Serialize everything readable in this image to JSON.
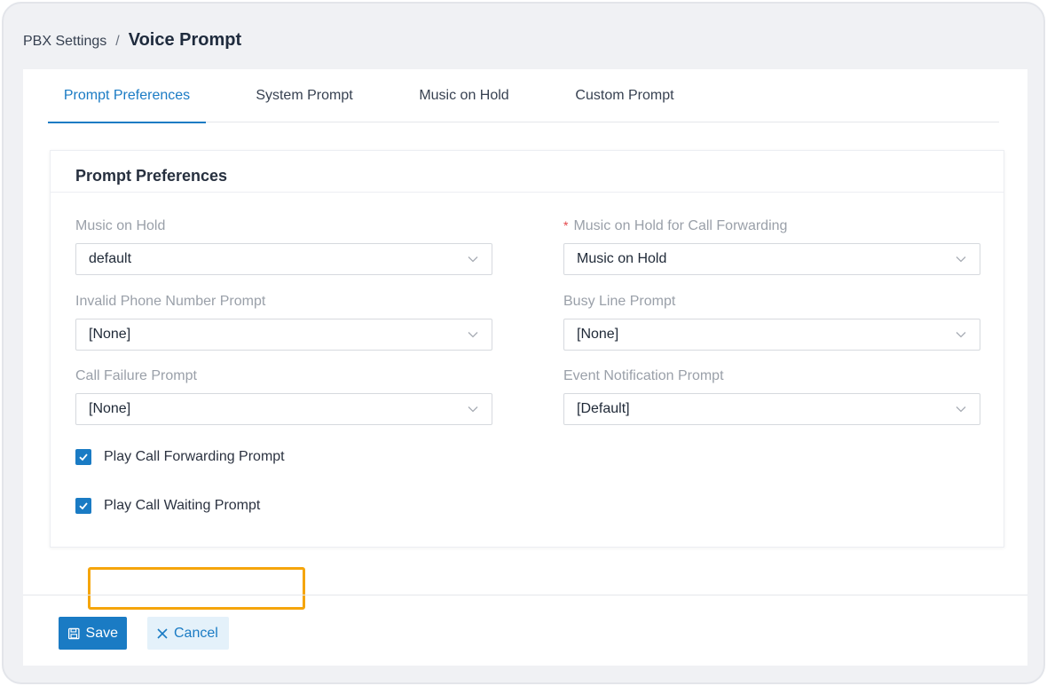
{
  "breadcrumb": {
    "parent": "PBX Settings",
    "separator": "/",
    "current": "Voice Prompt"
  },
  "tabs": [
    {
      "label": "Prompt Preferences",
      "active": true
    },
    {
      "label": "System Prompt",
      "active": false
    },
    {
      "label": "Music on Hold",
      "active": false
    },
    {
      "label": "Custom Prompt",
      "active": false
    }
  ],
  "section": {
    "title": "Prompt Preferences",
    "fields": {
      "music_on_hold": {
        "label": "Music on Hold",
        "value": "default"
      },
      "moh_call_forwarding": {
        "label": "Music on Hold for Call Forwarding",
        "required_mark": "*",
        "value": "Music on Hold"
      },
      "invalid_phone": {
        "label": "Invalid Phone Number Prompt",
        "value": "[None]"
      },
      "busy_line": {
        "label": "Busy Line Prompt",
        "value": "[None]"
      },
      "call_failure": {
        "label": "Call Failure Prompt",
        "value": "[None]"
      },
      "event_notification": {
        "label": "Event Notification Prompt",
        "value": "[Default]"
      }
    },
    "checkboxes": {
      "play_call_forwarding": {
        "label": "Play Call Forwarding Prompt",
        "checked": true
      },
      "play_call_waiting": {
        "label": "Play Call Waiting Prompt",
        "checked": true
      }
    }
  },
  "footer": {
    "save_label": "Save",
    "cancel_label": "Cancel"
  },
  "colors": {
    "accent": "#1a7bc4",
    "highlight": "#f5a50b",
    "required": "#e4474a"
  },
  "icons": {
    "save": "floppy-disk-icon",
    "cancel": "close-icon",
    "select": "chevron-down-icon",
    "check": "check-icon"
  }
}
